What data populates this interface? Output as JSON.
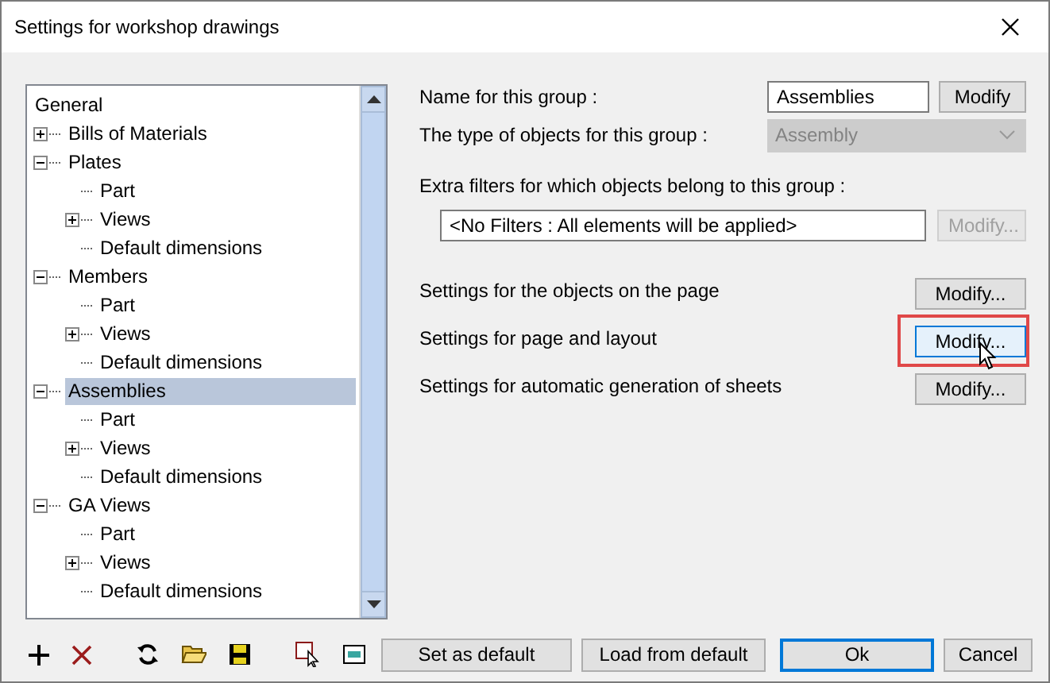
{
  "window": {
    "title": "Settings for workshop drawings"
  },
  "tree": [
    {
      "label": "General",
      "selected": false,
      "children": [
        {
          "label": "Bills of Materials",
          "expanded": false,
          "selected": false
        },
        {
          "label": "Plates",
          "expanded": true,
          "selected": false,
          "children": [
            {
              "label": "Part",
              "selected": false
            },
            {
              "label": "Views",
              "expanded": false,
              "selected": false
            },
            {
              "label": "Default dimensions",
              "selected": false
            }
          ]
        },
        {
          "label": "Members",
          "expanded": true,
          "selected": false,
          "children": [
            {
              "label": "Part",
              "selected": false
            },
            {
              "label": "Views",
              "expanded": false,
              "selected": false
            },
            {
              "label": "Default dimensions",
              "selected": false
            }
          ]
        },
        {
          "label": "Assemblies",
          "expanded": true,
          "selected": true,
          "children": [
            {
              "label": "Part",
              "selected": false
            },
            {
              "label": "Views",
              "expanded": false,
              "selected": false
            },
            {
              "label": "Default dimensions",
              "selected": false
            }
          ]
        },
        {
          "label": "GA Views",
          "expanded": true,
          "selected": false,
          "children": [
            {
              "label": "Part",
              "selected": false
            },
            {
              "label": "Views",
              "expanded": false,
              "selected": false
            },
            {
              "label": "Default dimensions",
              "selected": false
            }
          ]
        }
      ]
    }
  ],
  "name_group": {
    "label": "Name for this group :",
    "value": "Assemblies",
    "button": "Modify"
  },
  "type_group": {
    "label": "The type of objects for this group :",
    "value": "Assembly",
    "disabled": true
  },
  "filters": {
    "label": "Extra filters for which objects belong to this group :",
    "value": "<No Filters : All elements will be applied>",
    "button": "Modify...",
    "button_disabled": true
  },
  "settings": [
    {
      "label": "Settings for the objects on the page",
      "button": "Modify...",
      "highlighted": false
    },
    {
      "label": "Settings for page and layout",
      "button": "Modify...",
      "highlighted": true
    },
    {
      "label": "Settings for automatic generation of sheets",
      "button": "Modify...",
      "highlighted": false
    }
  ],
  "buttons": [
    {
      "label": "Set as default",
      "default": false
    },
    {
      "label": "Load from default",
      "default": false
    },
    {
      "label": "Ok",
      "default": true
    },
    {
      "label": "Cancel",
      "default": false
    }
  ]
}
